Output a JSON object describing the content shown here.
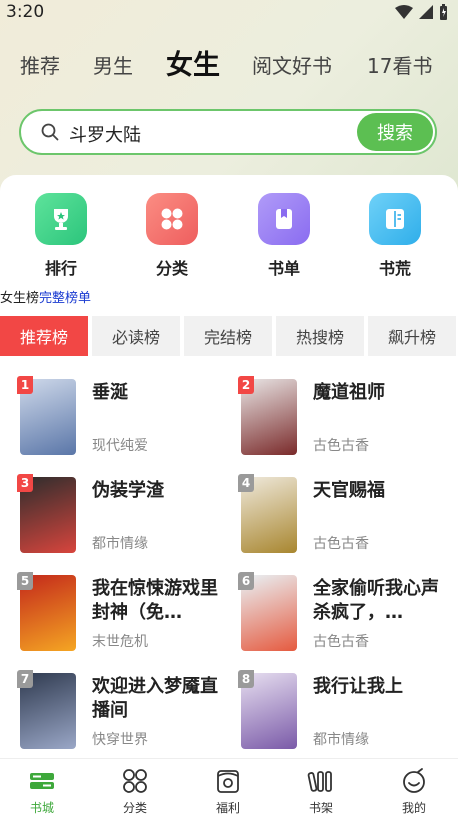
{
  "status": {
    "time": "3:20"
  },
  "top_tabs": [
    "推荐",
    "男生",
    "女生",
    "阅文好书",
    "17看书"
  ],
  "active_top_tab": "女生",
  "search": {
    "value": "斗罗大陆",
    "button": "搜索"
  },
  "quick_links": [
    {
      "label": "排行",
      "icon": "trophy-icon",
      "color": "#3fcf8a"
    },
    {
      "label": "分类",
      "icon": "grid-icon",
      "color": "#f36f6f"
    },
    {
      "label": "书单",
      "icon": "booklist-icon",
      "color": "#9b7ef2"
    },
    {
      "label": "书荒",
      "icon": "open-book-icon",
      "color": "#3fb8f0"
    }
  ],
  "ranking_header": {
    "prefix": "女生榜",
    "link": "完整榜单"
  },
  "rank_tabs": [
    "推荐榜",
    "必读榜",
    "完结榜",
    "热搜榜",
    "飙升榜"
  ],
  "books": [
    {
      "rank": "1",
      "title": "垂涎",
      "genre": "现代纯爱",
      "badge": "#f24745",
      "cover": [
        "#cfd9ea",
        "#5a76a8"
      ]
    },
    {
      "rank": "2",
      "title": "魔道祖师",
      "genre": "古色古香",
      "badge": "#f24745",
      "cover": [
        "#e9e6e6",
        "#7a2a2a"
      ]
    },
    {
      "rank": "3",
      "title": "伪装学渣",
      "genre": "都市情缘",
      "badge": "#f24745",
      "cover": [
        "#2d2d2d",
        "#d8453d"
      ]
    },
    {
      "rank": "4",
      "title": "天官赐福",
      "genre": "古色古香",
      "badge": "#9a9a9a",
      "cover": [
        "#efe9dc",
        "#a8862f"
      ]
    },
    {
      "rank": "5",
      "title": "我在惊悚游戏里封神（免…",
      "genre": "末世危机",
      "badge": "#9a9a9a",
      "cover": [
        "#c3281b",
        "#f5a623"
      ]
    },
    {
      "rank": "6",
      "title": "全家偷听我心声杀疯了，…",
      "genre": "古色古香",
      "badge": "#9a9a9a",
      "cover": [
        "#e9f2f6",
        "#e55a3f"
      ]
    },
    {
      "rank": "7",
      "title": "欢迎进入梦魇直播间",
      "genre": "快穿世界",
      "badge": "#9a9a9a",
      "cover": [
        "#2f3a4f",
        "#9aa7c7"
      ]
    },
    {
      "rank": "8",
      "title": "我行让我上",
      "genre": "都市情缘",
      "badge": "#9a9a9a",
      "cover": [
        "#e7dff0",
        "#7a5aa8"
      ]
    }
  ],
  "bottom_nav": [
    {
      "label": "书城",
      "icon": "bookstore-icon",
      "active": true
    },
    {
      "label": "分类",
      "icon": "category-icon",
      "active": false
    },
    {
      "label": "福利",
      "icon": "gift-icon",
      "active": false
    },
    {
      "label": "书架",
      "icon": "bookshelf-icon",
      "active": false
    },
    {
      "label": "我的",
      "icon": "profile-icon",
      "active": false
    }
  ],
  "colors": {
    "accent_green": "#5cbf52",
    "rank_red": "#f24745",
    "link_blue": "#1a3bd1"
  }
}
